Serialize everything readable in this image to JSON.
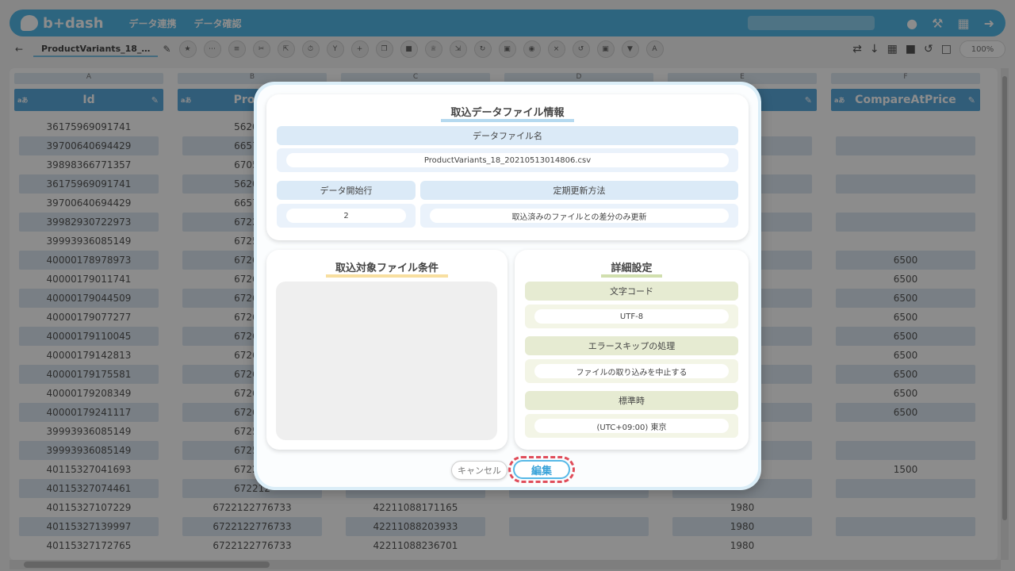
{
  "app": {
    "logo": "b+dash",
    "nav": [
      "データ連携",
      "データ確認"
    ],
    "file_tab": "ProductVariants_18_…",
    "zoom": "100%"
  },
  "grid": {
    "columns": [
      {
        "letter": "A",
        "header": "Id",
        "cells": [
          "36175969091741",
          "39700640694429",
          "39898366771357",
          "36175969091741",
          "39700640694429",
          "39982930722973",
          "39993936085149",
          "40000178978973",
          "40000179011741",
          "40000179044509",
          "40000179077277",
          "40000179110045",
          "40000179142813",
          "40000179175581",
          "40000179208349",
          "40000179241117",
          "39993936085149",
          "39993936085149",
          "40115327041693",
          "40115327074461",
          "40115327107229",
          "40115327139997",
          "40115327172765"
        ]
      },
      {
        "letter": "B",
        "header": "Produ",
        "cells": [
          "562001",
          "665762",
          "670538",
          "562001",
          "665762",
          "672212",
          "672548",
          "672688",
          "672688",
          "672688",
          "672688",
          "672688",
          "672688",
          "672688",
          "672688",
          "672688",
          "672548",
          "672548",
          "672212",
          "672212",
          "6722122776733",
          "6722122776733",
          "6722122776733"
        ]
      },
      {
        "letter": "C",
        "header": "",
        "cells": [
          "",
          "",
          "",
          "",
          "",
          "",
          "",
          "",
          "",
          "",
          "",
          "",
          "",
          "",
          "",
          "",
          "",
          "",
          "",
          "",
          "42211088171165",
          "42211088203933",
          "42211088236701"
        ]
      },
      {
        "letter": "D",
        "header": "",
        "cells": [
          "",
          "",
          "",
          "",
          "",
          "",
          "",
          "",
          "",
          "",
          "",
          "",
          "",
          "",
          "",
          "",
          "",
          "",
          "",
          "",
          "",
          "",
          ""
        ]
      },
      {
        "letter": "E",
        "header": "",
        "cells": [
          "",
          "",
          "",
          "",
          "",
          "",
          "",
          "",
          "",
          "",
          "",
          "",
          "",
          "",
          "",
          "",
          "",
          "",
          "",
          "",
          "1980",
          "1980",
          "1980"
        ]
      },
      {
        "letter": "F",
        "header": "CompareAtPrice",
        "cells": [
          "",
          "",
          "",
          "",
          "",
          "",
          "",
          "6500",
          "6500",
          "6500",
          "6500",
          "6500",
          "6500",
          "6500",
          "6500",
          "6500",
          "",
          "",
          "1500",
          "",
          "",
          "",
          ""
        ]
      }
    ]
  },
  "modal": {
    "file_info": {
      "title": "取込データファイル情報",
      "filename_label": "データファイル名",
      "filename_value": "ProductVariants_18_20210513014806.csv",
      "start_row_label": "データ開始行",
      "start_row_value": "2",
      "update_method_label": "定期更新方法",
      "update_method_value": "取込済みのファイルとの差分のみ更新"
    },
    "conditions": {
      "title": "取込対象ファイル条件"
    },
    "details": {
      "title": "詳細設定",
      "encoding_label": "文字コード",
      "encoding_value": "UTF-8",
      "error_label": "エラースキップの処理",
      "error_value": "ファイルの取り込みを中止する",
      "timezone_label": "標準時",
      "timezone_value": "(UTC+09:00) 東京"
    },
    "buttons": {
      "cancel": "キャンセル",
      "edit": "編集"
    }
  }
}
